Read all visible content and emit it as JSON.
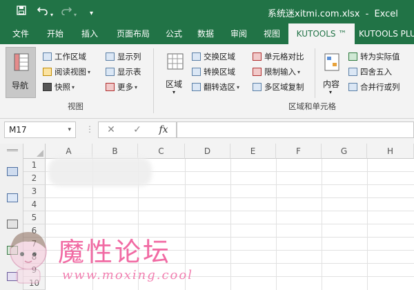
{
  "title_bar": {
    "filename": "系统迷xitmi.com.xlsx",
    "separator": "-",
    "app_name": "Excel",
    "icons": [
      "save-icon",
      "undo-icon",
      "redo-icon",
      "customize-qat-icon"
    ]
  },
  "tabs": [
    "文件",
    "开始",
    "插入",
    "页面布局",
    "公式",
    "数据",
    "审阅",
    "视图",
    "KUTOOLS ™",
    "KUTOOLS PLU"
  ],
  "active_tab": "KUTOOLS ™",
  "ribbon": {
    "view_group": {
      "label": "视图",
      "nav_button": "导航",
      "items": [
        "工作区域",
        "阅读视图",
        "快照",
        "显示列",
        "显示表",
        "更多"
      ]
    },
    "range_group": {
      "label": "区域和单元格",
      "range_button": "区域",
      "content_button": "内容",
      "items": [
        "交换区域",
        "转换区域",
        "翻转选区",
        "单元格对比",
        "限制输入",
        "多区域复制",
        "转为实际值",
        "四舍五入",
        "合并行或列"
      ]
    }
  },
  "formula_bar": {
    "name_box": "M17",
    "cancel": "✕",
    "enter": "✓",
    "fx": "fx",
    "value": ""
  },
  "grid": {
    "columns": [
      "A",
      "B",
      "C",
      "D",
      "E",
      "F",
      "G",
      "H"
    ],
    "rows": [
      "1",
      "2",
      "3",
      "4",
      "5",
      "6",
      "7",
      "8",
      "9",
      "10"
    ]
  },
  "watermark": {
    "main": "魔性论坛",
    "url": "www.moxing.cool"
  }
}
